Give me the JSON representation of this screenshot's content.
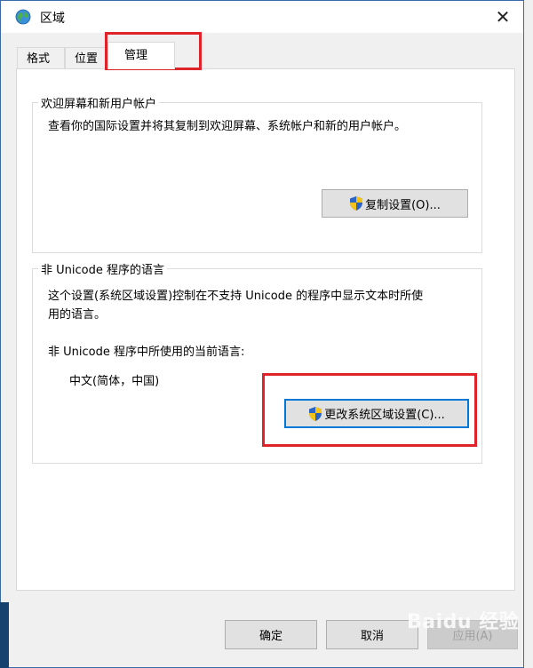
{
  "window": {
    "title": "区域",
    "close_glyph": "✕"
  },
  "tabs": [
    {
      "label": "格式",
      "active": false
    },
    {
      "label": "位置",
      "active": false
    },
    {
      "label": "管理",
      "active": true
    }
  ],
  "welcome_group": {
    "title": "欢迎屏幕和新用户帐户",
    "description": "查看你的国际设置并将其复制到欢迎屏幕、系统帐户和新的用户帐户。",
    "copy_button": "复制设置(O)..."
  },
  "unicode_group": {
    "title": "非 Unicode 程序的语言",
    "description_line1": "这个设置(系统区域设置)控制在不支持 Unicode 的程序中显示文本时所使",
    "description_line2": "用的语言。",
    "current_label": "非 Unicode 程序中所使用的当前语言:",
    "current_value": "中文(简体，中国)",
    "change_button": "更改系统区域设置(C)..."
  },
  "footer": {
    "ok_button": "确定",
    "cancel_button": "取消",
    "apply_button": "应用(A)"
  },
  "watermark": {
    "text": "Baidu 经验"
  },
  "colors": {
    "highlight": "#e0222a",
    "focus_border": "#0078d7",
    "shield_blue": "#2a64c5",
    "shield_yellow": "#f3c31a"
  },
  "icons": {
    "title": "globe-icon",
    "close": "close-icon",
    "uac": "uac-shield-icon"
  }
}
